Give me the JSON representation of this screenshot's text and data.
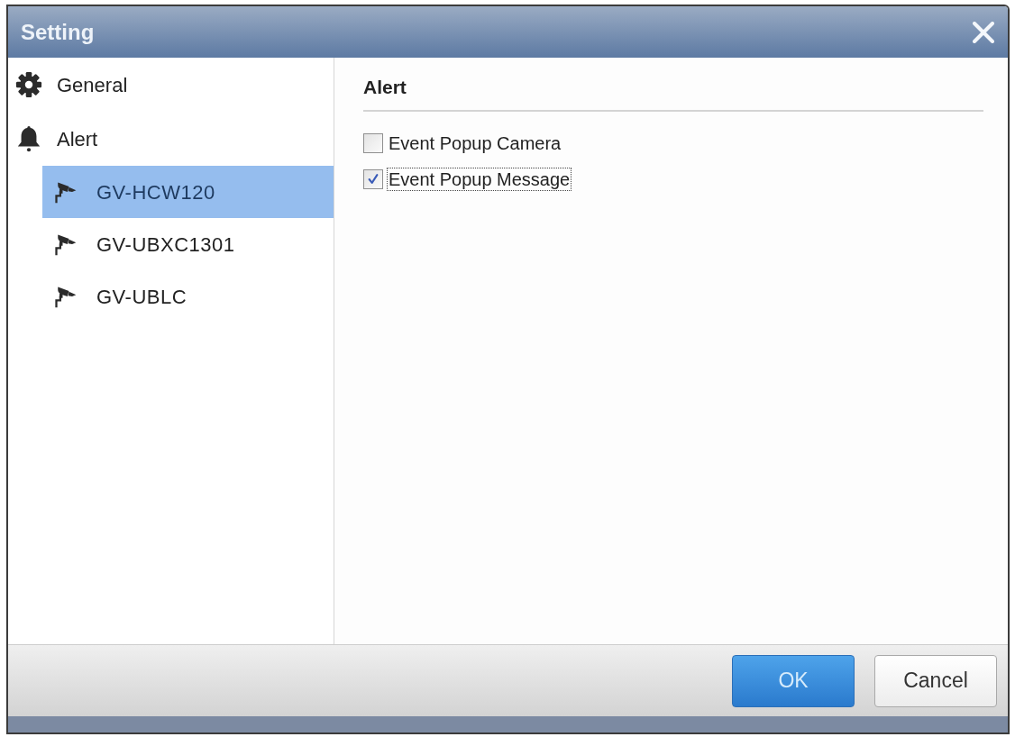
{
  "window": {
    "title": "Setting"
  },
  "sidebar": {
    "items": [
      {
        "label": "General",
        "selected": false
      },
      {
        "label": "Alert",
        "selected": false,
        "children": [
          {
            "label": "GV-HCW120",
            "selected": true
          },
          {
            "label": "GV-UBXC1301",
            "selected": false
          },
          {
            "label": "GV-UBLC",
            "selected": false
          }
        ]
      }
    ]
  },
  "panel": {
    "title": "Alert",
    "options": [
      {
        "label": "Event Popup Camera",
        "checked": false,
        "focused": false
      },
      {
        "label": "Event Popup Message",
        "checked": true,
        "focused": true
      }
    ]
  },
  "buttons": [
    {
      "label": "OK",
      "primary": true
    },
    {
      "label": "Cancel",
      "primary": false
    }
  ]
}
